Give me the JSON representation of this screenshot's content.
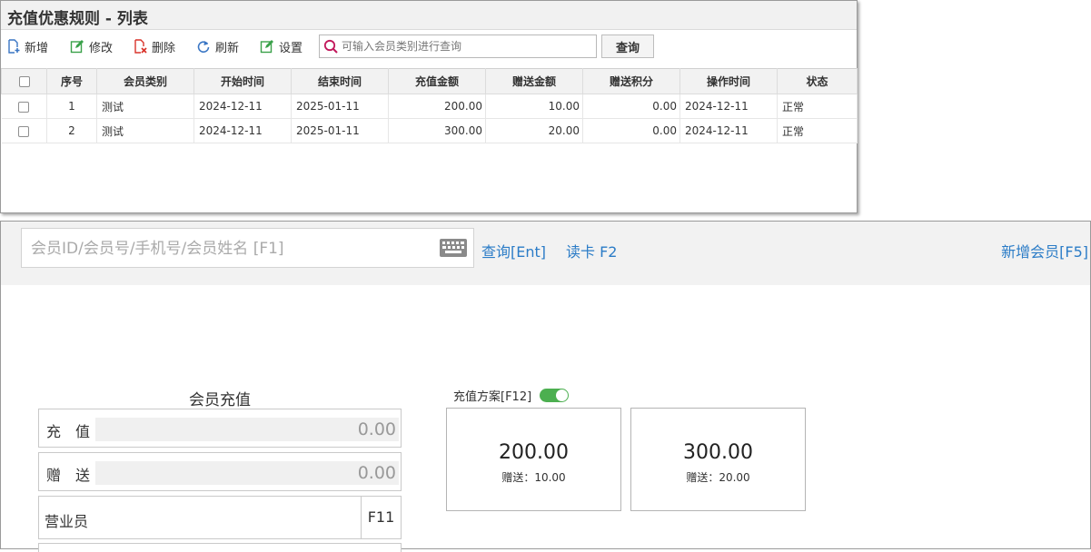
{
  "list_window": {
    "title": "充值优惠规则 - 列表",
    "toolbar": {
      "add_label": "新增",
      "edit_label": "修改",
      "delete_label": "删除",
      "refresh_label": "刷新",
      "settings_label": "设置",
      "search_placeholder": "可输入会员类别进行查询",
      "query_label": "查询"
    },
    "columns": [
      "序号",
      "会员类别",
      "开始时间",
      "结束时间",
      "充值金额",
      "赠送金额",
      "赠送积分",
      "操作时间",
      "状态"
    ],
    "rows": [
      {
        "no": "1",
        "category": "测试",
        "start": "2024-12-11",
        "end": "2025-01-11",
        "amount": "200.00",
        "bonus": "10.00",
        "points": "0.00",
        "op_time": "2024-12-11",
        "status": "正常"
      },
      {
        "no": "2",
        "category": "测试",
        "start": "2024-12-11",
        "end": "2025-01-11",
        "amount": "300.00",
        "bonus": "20.00",
        "points": "0.00",
        "op_time": "2024-12-11",
        "status": "正常"
      }
    ]
  },
  "member_panel": {
    "search_placeholder": "会员ID/会员号/手机号/会员姓名 [F1]",
    "query_link": "查询[Ent]",
    "read_card_link": "读卡 F2",
    "add_member_link": "新增会员[F5]",
    "recharge_title": "会员充值",
    "recharge_label": "充　值",
    "recharge_value": "0.00",
    "bonus_label": "赠　送",
    "bonus_value": "0.00",
    "clerk_label": "营业员",
    "clerk_key": "F11",
    "plan_label": "充值方案[F12]",
    "plan_toggle_on": true,
    "plans": [
      {
        "amount": "200.00",
        "bonus": "赠送：10.00"
      },
      {
        "amount": "300.00",
        "bonus": "赠送：20.00"
      }
    ]
  },
  "colors": {
    "link": "#2b7cc7",
    "toggle_on": "#4caf50",
    "add_icon": "#3a76c4",
    "edit_icon": "#3aa14a",
    "delete_icon": "#d9342b",
    "search_icon": "#c2185b"
  }
}
